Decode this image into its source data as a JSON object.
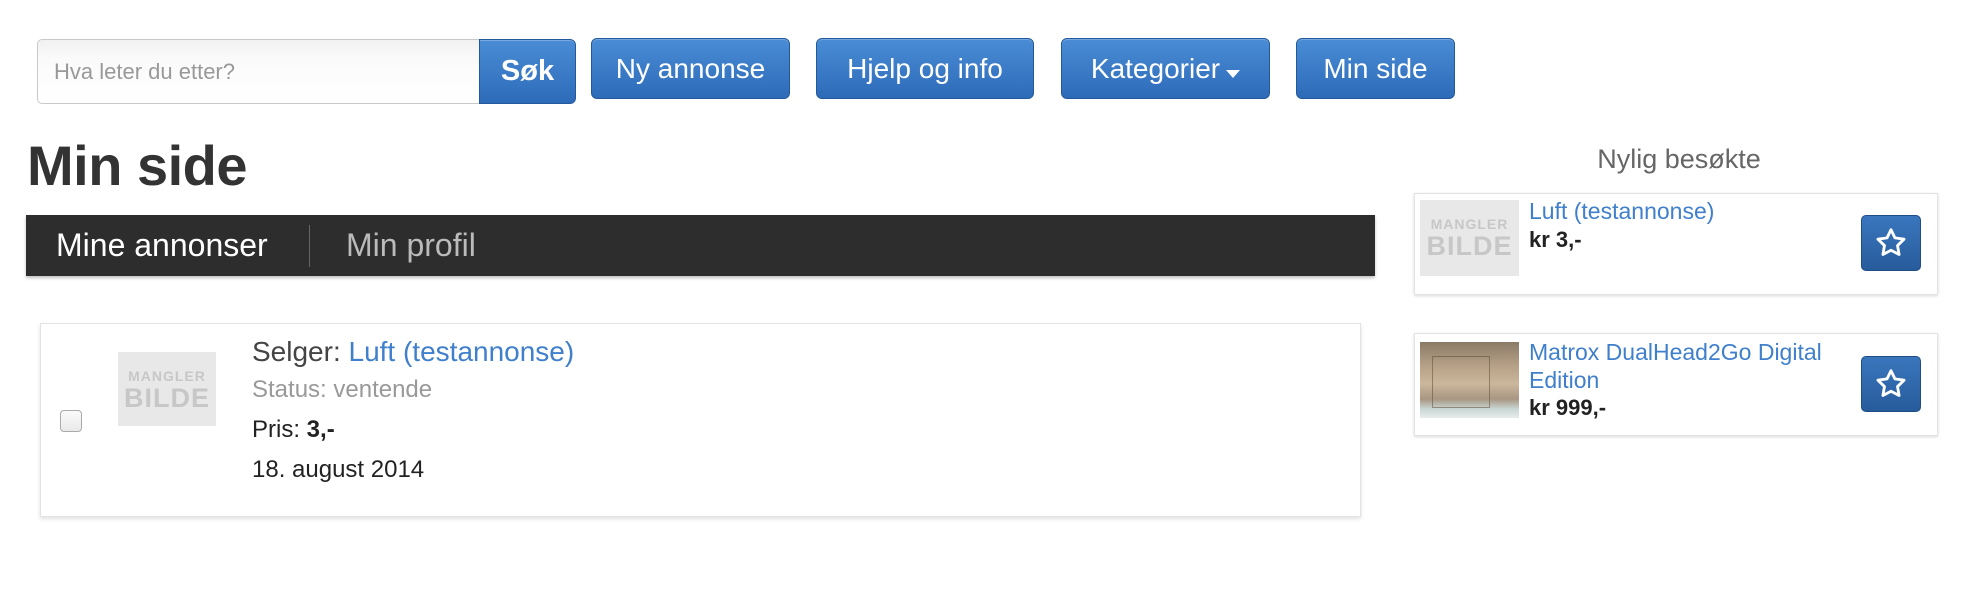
{
  "toolbar": {
    "search_placeholder": "Hva leter du etter?",
    "search_button": "Søk",
    "new_ad": "Ny annonse",
    "help": "Hjelp og info",
    "categories": "Kategorier",
    "my_page": "Min side"
  },
  "page": {
    "title": "Min side"
  },
  "tabs": [
    {
      "label": "Mine annonser",
      "active": true
    },
    {
      "label": "Min profil",
      "active": false
    }
  ],
  "listing": {
    "image_placeholder": {
      "line1": "MANGLER",
      "line2": "BILDE"
    },
    "seller_label": "Selger:",
    "seller_value": "Luft (testannonse)",
    "status": "Status: ventende",
    "price_label": "Pris:",
    "price_value": "3,-",
    "date": "18. august 2014",
    "checked": false
  },
  "sidebar": {
    "title": "Nylig besøkte",
    "items": [
      {
        "title": "Luft (testannonse)",
        "price": "kr 3,-",
        "image_placeholder": {
          "line1": "MANGLER",
          "line2": "BILDE"
        },
        "icon": "star-icon"
      },
      {
        "title": "Matrox DualHead2Go Digital Edition",
        "price": "kr 999,-",
        "icon": "star-icon"
      }
    ]
  },
  "colors": {
    "accent": "#2d6bb8",
    "link": "#3f7fcc",
    "tabbar": "#2d2d2d"
  }
}
